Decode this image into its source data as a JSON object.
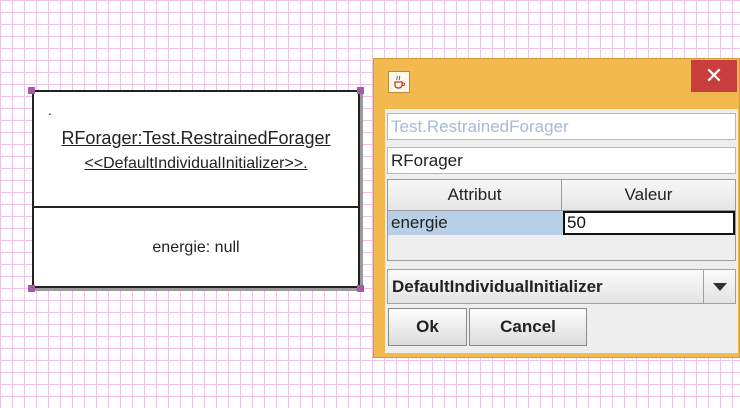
{
  "uml_node": {
    "dot": ".",
    "instance_label": "RForager:Test.RestrainedForager",
    "stereotype": "<<DefaultIndividualInitializer>>.",
    "attribute": "energie: null"
  },
  "dialog": {
    "close_symbol": "✕",
    "class_field": "Test.RestrainedForager",
    "name_field": "RForager",
    "table": {
      "columns": [
        "Attribut",
        "Valeur"
      ],
      "rows": [
        {
          "key": "energie",
          "value": "50"
        }
      ]
    },
    "initializer_select": {
      "selected": "DefaultIndividualInitializer"
    },
    "ok_label": "Ok",
    "cancel_label": "Cancel"
  },
  "colors": {
    "title_bar": "#f2b94f",
    "close_button": "#c83d3d",
    "selected_cell": "#b8cfe5",
    "grid": "#efc2e7"
  },
  "icons": {
    "window": "java-cup-icon",
    "dropdown": "chevron-down-icon"
  }
}
